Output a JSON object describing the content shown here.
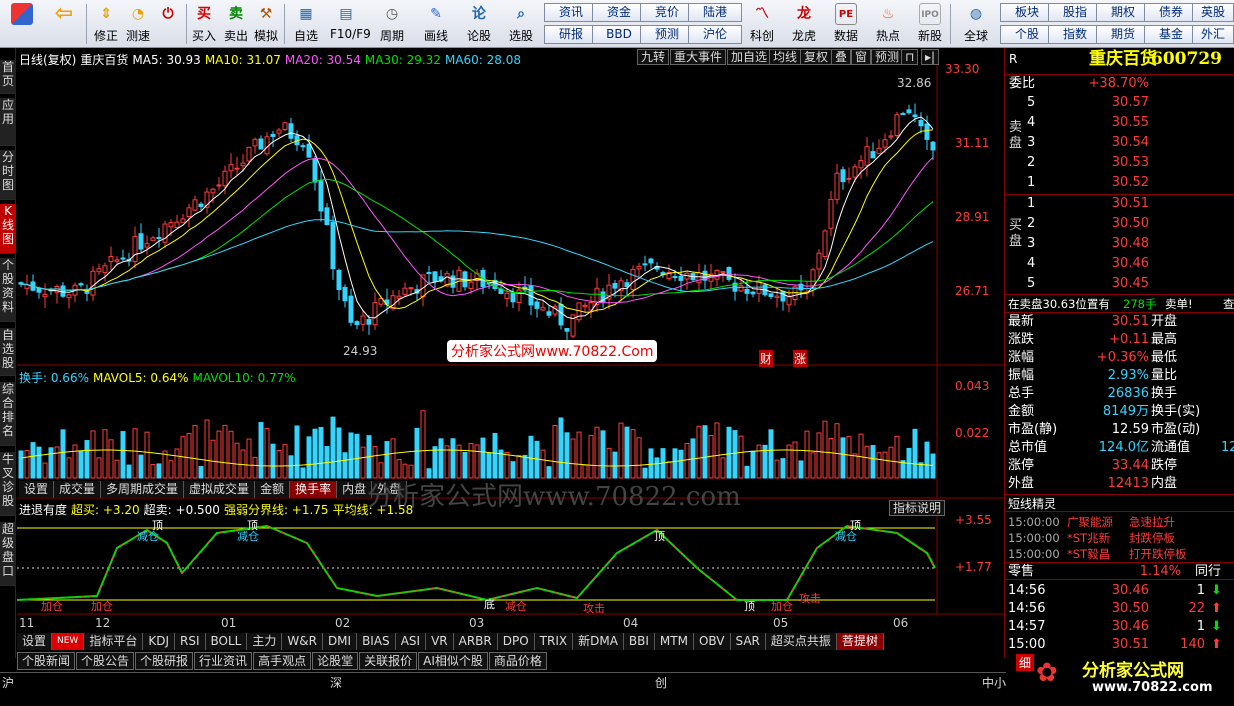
{
  "toolbar": {
    "buttons": [
      {
        "label": "",
        "icon": "grid-icon"
      },
      {
        "label": "",
        "icon": "back-arrow-icon"
      },
      {
        "label": "修正",
        "icon": "arrow-up-down-icon"
      },
      {
        "label": "测速",
        "icon": "clock-icon"
      },
      {
        "label": "",
        "icon": "power-icon"
      },
      {
        "label": "买入",
        "icon": "buy-icon"
      },
      {
        "label": "卖出",
        "icon": "sell-icon"
      },
      {
        "label": "模拟",
        "icon": "hammer-icon"
      },
      {
        "label": "自选",
        "icon": "folder-icon"
      },
      {
        "label": "F10/F9",
        "icon": "document-icon"
      },
      {
        "label": "周期",
        "icon": "cycle-icon"
      },
      {
        "label": "画线",
        "icon": "pencil-icon"
      },
      {
        "label": "论股",
        "icon": "talk-icon"
      },
      {
        "label": "选股",
        "icon": "search-icon"
      },
      {
        "label": "科创",
        "icon": "science-icon"
      },
      {
        "label": "龙虎",
        "icon": "dragon-icon"
      },
      {
        "label": "数据",
        "icon": "pe-icon"
      },
      {
        "label": "热点",
        "icon": "fire-icon"
      },
      {
        "label": "新股",
        "icon": "ipo-icon"
      },
      {
        "label": "全球",
        "icon": "globe-icon"
      }
    ],
    "quick_row1": [
      "资讯",
      "资金",
      "竞价",
      "陆港",
      "板块",
      "股指",
      "期权",
      "债券",
      "英股"
    ],
    "quick_row2": [
      "研报",
      "BBD",
      "预测",
      "沪伦",
      "个股",
      "指数",
      "期货",
      "基金",
      "外汇"
    ]
  },
  "left_tabs": [
    "首页",
    "应用",
    "分时图",
    "K线图",
    "个股资料",
    "自选股",
    "综合排名",
    "牛叉诊股",
    "超级盘口"
  ],
  "chart": {
    "main_legend": {
      "title": "日线(复权)",
      "name": "重庆百货",
      "ma5": "MA5: 30.93",
      "ma10": "MA10: 31.07",
      "ma20": "MA20: 30.54",
      "ma30": "MA30: 29.32",
      "ma60": "MA60: 28.08",
      "arrow_down": "↓",
      "arrow_up": "↑"
    },
    "top_buttons": [
      "九转",
      "重大事件",
      "加自选",
      "均线",
      "复权",
      "叠",
      "窗",
      "预测"
    ],
    "price_axis": [
      "33.30",
      "31.11",
      "28.91",
      "26.71"
    ],
    "high_label": "32.86",
    "low_label": "24.93",
    "annotation_cai": "财",
    "annotation_zhang": "涨",
    "watermark_red": "分析家公式网www.70822.Com",
    "watermark_center": "分析家公式网www.70822.com",
    "vol_legend": {
      "a": "换手: 0.66%",
      "b": "MAVOL5: 0.64%",
      "c": "MAVOL10: 0.77%"
    },
    "vol_axis": [
      "0.043",
      "0.022"
    ],
    "vol_tabs": [
      "设置",
      "成交量",
      "多周期成交量",
      "虚拟成交量",
      "金额",
      "换手率",
      "内盘",
      "外盘"
    ],
    "indicator_legend": {
      "name": "进退有度",
      "a": "超买: +3.20",
      "b": "超卖: +0.500",
      "c": "强弱分界线: +1.75",
      "d": "平均线: +1.58"
    },
    "indicator_button": "指标说明",
    "indicator_axis": [
      "+3.55",
      "+1.77"
    ],
    "indicator_labels": [
      "加仓",
      "加仓",
      "减仓",
      "减仓",
      "减仓",
      "攻击",
      "顶",
      "顶",
      "顶",
      "顶",
      "底",
      "加仓",
      "攻击",
      "减仓",
      "顶"
    ],
    "x_axis": [
      "11",
      "12",
      "01",
      "02",
      "03",
      "04",
      "05",
      "06"
    ],
    "bottom_tabs": [
      "设置",
      "NEW",
      "指标平台",
      "KDJ",
      "RSI",
      "BOLL",
      "主力",
      "W&R",
      "DMI",
      "BIAS",
      "ASI",
      "VR",
      "ARBR",
      "DPO",
      "TRIX",
      "新DMA",
      "BBI",
      "MTM",
      "OBV",
      "SAR",
      "超买点共振",
      "菩提树"
    ],
    "news_tabs": [
      "个股新闻",
      "个股公告",
      "个股研报",
      "行业资讯",
      "高手观点",
      "论股堂",
      "关联报价",
      "AI相似个股",
      "商品价格"
    ]
  },
  "chart_data": {
    "type": "candlestick",
    "title": "重庆百货",
    "ylim": [
      24.5,
      33.5
    ],
    "high": 32.86,
    "low": 24.93,
    "x": [
      "11",
      "12",
      "01",
      "02",
      "03",
      "04",
      "05",
      "06"
    ],
    "ma_last": {
      "MA5": 30.93,
      "MA10": 31.07,
      "MA20": 30.54,
      "MA30": 29.32,
      "MA60": 28.08
    }
  },
  "quote": {
    "r_label": "R",
    "stock_name": "重庆百货",
    "stock_code": "600729",
    "weibi_label": "委比",
    "weibi_value": "+38.70%",
    "sell_label": "卖盘",
    "buy_label": "买盘",
    "sells": [
      {
        "n": "5",
        "price": "30.57"
      },
      {
        "n": "4",
        "price": "30.55"
      },
      {
        "n": "3",
        "price": "30.54"
      },
      {
        "n": "2",
        "price": "30.53"
      },
      {
        "n": "1",
        "price": "30.52"
      }
    ],
    "buys": [
      {
        "n": "1",
        "price": "30.51"
      },
      {
        "n": "2",
        "price": "30.50"
      },
      {
        "n": "3",
        "price": "30.48"
      },
      {
        "n": "4",
        "price": "30.46"
      },
      {
        "n": "5",
        "price": "30.45"
      }
    ],
    "info_line": "在卖盘30.63位置有",
    "info_vol": "278手",
    "info_tail": "卖单!",
    "info_end": "查",
    "stats": [
      {
        "l": "最新",
        "v": "30.51",
        "r": "开盘"
      },
      {
        "l": "涨跌",
        "v": "+0.11",
        "r": "最高"
      },
      {
        "l": "涨幅",
        "v": "+0.36%",
        "r": "最低"
      },
      {
        "l": "振幅",
        "v": "2.93%",
        "r": "量比"
      },
      {
        "l": "总手",
        "v": "26836",
        "r": "换手"
      },
      {
        "l": "金额",
        "v": "8149万",
        "r": "换手(实)"
      },
      {
        "l": "市盈(静)",
        "v": "12.59",
        "r": "市盈(动)"
      },
      {
        "l": "总市值",
        "v": "124.0亿",
        "r": "流通值",
        "extra": "12"
      },
      {
        "l": "涨停",
        "v": "33.44",
        "r": "跌停"
      },
      {
        "l": "外盘",
        "v": "12413",
        "r": "内盘"
      }
    ],
    "short_title": "短线精灵",
    "short_items": [
      {
        "t": "15:00:00",
        "name": "广聚能源",
        "ev": "急速拉升"
      },
      {
        "t": "15:00:00",
        "name": "*ST兆新",
        "ev": "封跌停板"
      },
      {
        "t": "15:00:00",
        "name": "*ST毅昌",
        "ev": "打开跌停板"
      }
    ],
    "zero_label": "零售",
    "zero_pct": "1.14%",
    "zero_tail": "同行",
    "ticks": [
      {
        "t": "14:56",
        "p": "30.46",
        "v": "1",
        "dir": "down"
      },
      {
        "t": "14:56",
        "p": "30.50",
        "v": "22",
        "dir": "up"
      },
      {
        "t": "14:57",
        "p": "30.46",
        "v": "1",
        "dir": "down"
      },
      {
        "t": "15:00",
        "p": "30.51",
        "v": "140",
        "dir": "up"
      }
    ]
  },
  "status": {
    "a": "沪",
    "b": "深",
    "c": "创",
    "d": "中小板",
    "fine": "细"
  },
  "logo": {
    "line1": "分析家公式网",
    "line2": "www.70822.com"
  }
}
